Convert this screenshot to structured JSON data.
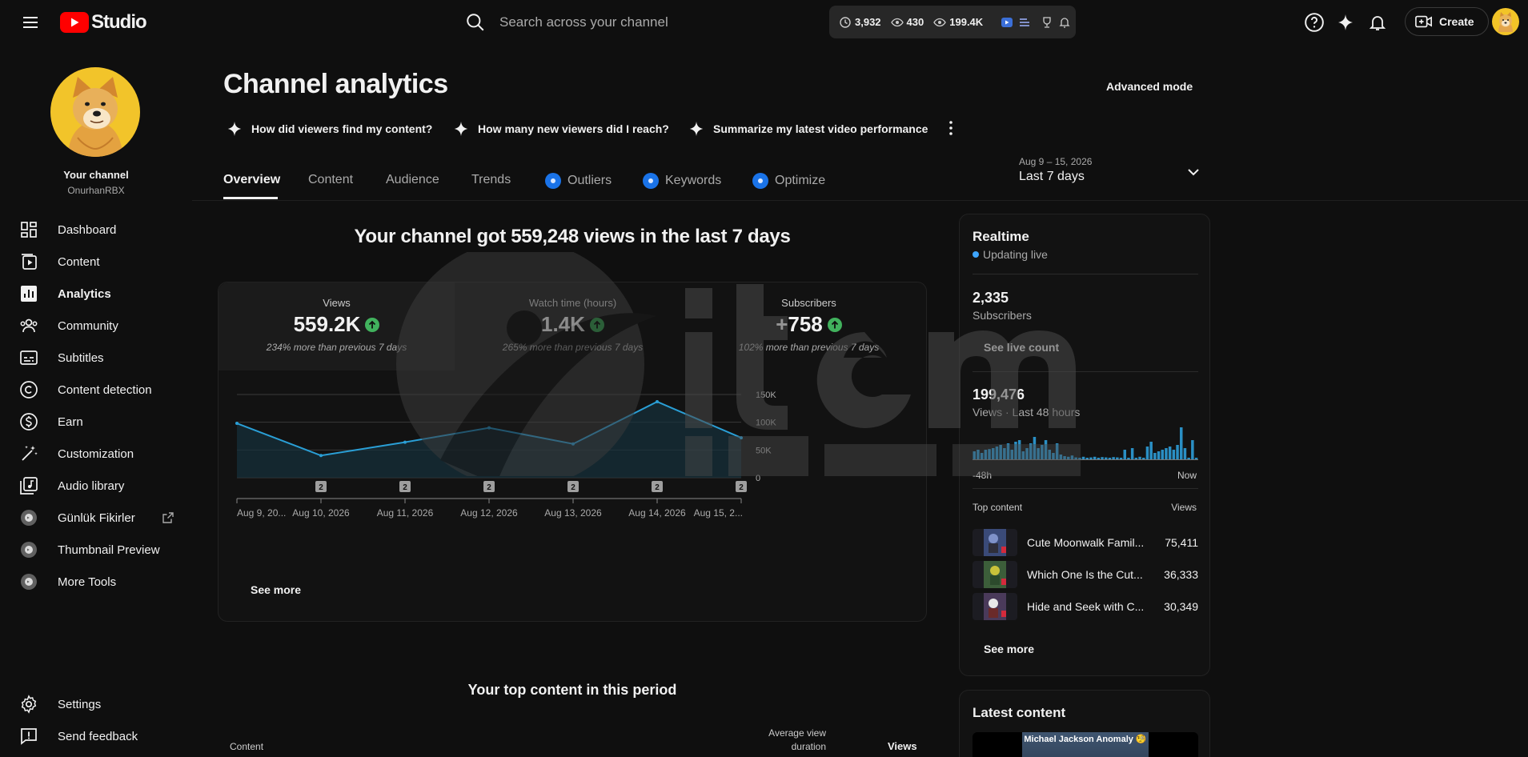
{
  "topbar": {
    "logo_text": "Studio",
    "search_placeholder": "Search across your channel",
    "stats": [
      {
        "icon": "clock-icon",
        "value": "3,932"
      },
      {
        "icon": "eye-icon",
        "value": "430"
      },
      {
        "icon": "eye-icon",
        "value": "199.4K"
      }
    ],
    "create_label": "Create"
  },
  "sidebar": {
    "channel_title": "Your channel",
    "channel_name": "OnurhanRBX",
    "items": [
      {
        "label": "Dashboard",
        "icon": "dashboard-icon"
      },
      {
        "label": "Content",
        "icon": "content-icon"
      },
      {
        "label": "Analytics",
        "icon": "analytics-icon",
        "active": true
      },
      {
        "label": "Community",
        "icon": "community-icon"
      },
      {
        "label": "Subtitles",
        "icon": "subtitles-icon"
      },
      {
        "label": "Content detection",
        "icon": "copyright-icon"
      },
      {
        "label": "Earn",
        "icon": "earn-icon"
      },
      {
        "label": "Customization",
        "icon": "customization-icon"
      },
      {
        "label": "Audio library",
        "icon": "audio-library-icon"
      },
      {
        "label": "Günlük Fikirler",
        "icon": "extension-icon"
      },
      {
        "label": "Thumbnail Preview",
        "icon": "extension-icon"
      },
      {
        "label": "More Tools",
        "icon": "extension-icon"
      }
    ],
    "bottom": [
      {
        "label": "Settings",
        "icon": "settings-icon"
      },
      {
        "label": "Send feedback",
        "icon": "feedback-icon"
      }
    ]
  },
  "main": {
    "title": "Channel analytics",
    "advanced_mode": "Advanced mode",
    "chips": [
      "How did viewers find my content?",
      "How many new viewers did I reach?",
      "Summarize my latest video performance"
    ],
    "tabs": [
      "Overview",
      "Content",
      "Audience",
      "Trends",
      "Outliers",
      "Keywords",
      "Optimize"
    ],
    "date_range": {
      "sub": "Aug 9 – 15, 2026",
      "label": "Last 7 days"
    },
    "headline": "Your channel got 559,248 views in the last 7 days",
    "metrics": [
      {
        "label": "Views",
        "value": "559.2K",
        "sub": "234% more than previous 7 days"
      },
      {
        "label": "Watch time (hours)",
        "value": "1.4K",
        "sub": "265% more than previous 7 days"
      },
      {
        "label": "Subscribers",
        "value": "+758",
        "sub": "102% more than previous 7 days"
      }
    ],
    "see_more": "See more",
    "top_content_title": "Your top content in this period",
    "table_headers": {
      "content": "Content",
      "avg_duration": "Average view duration",
      "views": "Views"
    }
  },
  "chart_data": {
    "type": "area",
    "x": [
      "Aug 9, 20...",
      "Aug 10, 2026",
      "Aug 11, 2026",
      "Aug 12, 2026",
      "Aug 13, 2026",
      "Aug 14, 2026",
      "Aug 15, 2..."
    ],
    "series": [
      {
        "values": [
          98000,
          40000,
          64000,
          90000,
          61000,
          137000,
          72000
        ]
      }
    ],
    "y_ticks": [
      "0",
      "50K",
      "100K",
      "150K"
    ],
    "ylim": [
      0,
      150000
    ],
    "markers": [
      {
        "x": "Aug 10, 2026",
        "label": "2"
      },
      {
        "x": "Aug 11, 2026",
        "label": "2"
      },
      {
        "x": "Aug 12, 2026",
        "label": "2"
      },
      {
        "x": "Aug 13, 2026",
        "label": "2"
      },
      {
        "x": "Aug 14, 2026",
        "label": "2"
      },
      {
        "x": "Aug 15, 2...",
        "label": "2"
      }
    ],
    "line_color": "#2a9fd6",
    "grid": true
  },
  "realtime": {
    "title": "Realtime",
    "live": "Updating live",
    "subscribers": "2,335",
    "subscribers_label": "Subscribers",
    "see_live_count": "See live count",
    "views": "199,476",
    "views_label": "Views · Last 48 hours",
    "axis_start": "-48h",
    "axis_end": "Now",
    "hourly_bars": [
      0.25,
      0.3,
      0.2,
      0.3,
      0.32,
      0.35,
      0.4,
      0.45,
      0.35,
      0.5,
      0.3,
      0.55,
      0.6,
      0.25,
      0.35,
      0.5,
      0.7,
      0.35,
      0.45,
      0.6,
      0.3,
      0.2,
      0.5,
      0.15,
      0.1,
      0.08,
      0.12,
      0.06,
      0.05,
      0.08,
      0.05,
      0.06,
      0.08,
      0.05,
      0.07,
      0.06,
      0.05,
      0.07,
      0.06,
      0.05,
      0.3,
      0.05,
      0.35,
      0.05,
      0.08,
      0.05,
      0.4,
      0.55,
      0.2,
      0.25,
      0.3,
      0.35,
      0.4,
      0.3,
      0.45,
      1.0,
      0.35,
      0.05,
      0.6,
      0.05
    ],
    "top_content_label": "Top content",
    "views_col": "Views",
    "top_content": [
      {
        "title": "Cute Moonwalk Famil...",
        "views": "75,411"
      },
      {
        "title": "Which One Is the Cut...",
        "views": "36,333"
      },
      {
        "title": "Hide and Seek with C...",
        "views": "30,349"
      }
    ],
    "see_more": "See more"
  },
  "latest": {
    "title": "Latest content",
    "thumb_caption": "Michael Jackson Anomaly 🧐"
  },
  "colors": {
    "accent": "#3ea6ff",
    "line": "#2a9fd6",
    "up": "#41b25d",
    "youtube_red": "#ff0000"
  }
}
